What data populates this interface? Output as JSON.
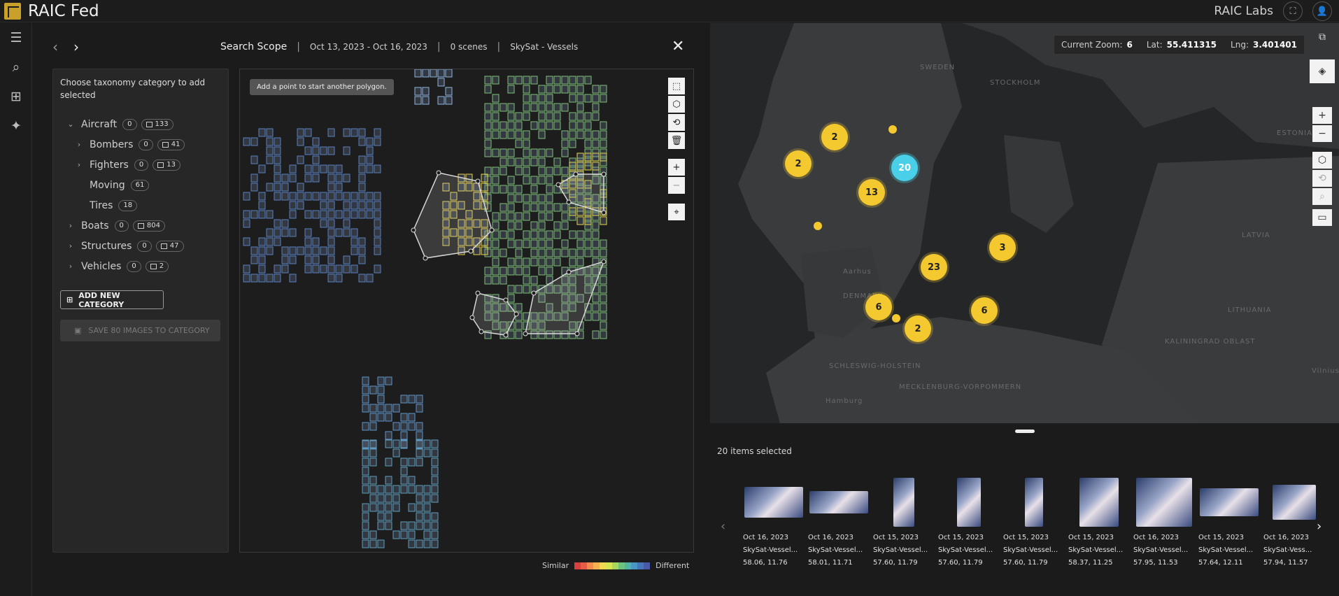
{
  "app": {
    "title": "RAIC Fed",
    "org": "RAIC Labs"
  },
  "scope": {
    "title": "Search Scope",
    "date_range": "Oct 13, 2023 - Oct 16, 2023",
    "scenes": "0 scenes",
    "source": "SkySat - Vessels",
    "sep": "|"
  },
  "taxonomy": {
    "hint": "Choose taxonomy category to add selected",
    "items": [
      {
        "label": "Aircraft",
        "count": "0",
        "images": "133",
        "level": 0,
        "chevron": "v"
      },
      {
        "label": "Bombers",
        "count": "0",
        "images": "41",
        "level": 1,
        "chevron": ">"
      },
      {
        "label": "Fighters",
        "count": "0",
        "images": "13",
        "level": 1,
        "chevron": ">"
      },
      {
        "label": "Moving",
        "count": "61",
        "images": "",
        "level": 1,
        "chevron": ""
      },
      {
        "label": "Tires",
        "count": "18",
        "images": "",
        "level": 1,
        "chevron": ""
      },
      {
        "label": "Boats",
        "count": "0",
        "images": "804",
        "level": 0,
        "chevron": ">"
      },
      {
        "label": "Structures",
        "count": "0",
        "images": "47",
        "level": 0,
        "chevron": ">"
      },
      {
        "label": "Vehicles",
        "count": "0",
        "images": "2",
        "level": 0,
        "chevron": ">"
      }
    ],
    "add_button": "ADD NEW CATEGORY",
    "save_button": "SAVE 80 IMAGES TO CATEGORY"
  },
  "search_map": {
    "tip": "Add a point to start another polygon."
  },
  "legend": {
    "similar": "Similar",
    "different": "Different",
    "colors": [
      "#d8403f",
      "#e85c45",
      "#f28a4d",
      "#f6b14f",
      "#f2d94f",
      "#d6e453",
      "#a5d85b",
      "#6cc37d",
      "#4fb3a5",
      "#4a97c4",
      "#4476bd",
      "#4a5aa8"
    ]
  },
  "world_map": {
    "zoom_label": "Current Zoom:",
    "zoom": "6",
    "lat_label": "Lat:",
    "lat": "55.411315",
    "lng_label": "Lng:",
    "lng": "3.401401",
    "places": [
      "SWEDEN",
      "STOCKHOLM",
      "ESTONIA",
      "LATVIA",
      "LITHUANIA",
      "KALININGRAD OBLAST",
      "DENMARK",
      "SCHLESWIG-HOLSTEIN",
      "MECKLENBURG-VORPOMMERN",
      "Aarhus",
      "Hamburg",
      "Vilnius"
    ],
    "clusters": [
      "2",
      "2",
      "20",
      "13",
      "3",
      "23",
      "6",
      "6",
      "2"
    ]
  },
  "results": {
    "selected": "20 items selected",
    "thumbnails": [
      {
        "date": "Oct 16, 2023",
        "name": "SkySat-Vessel...",
        "coords": "58.06, 11.76"
      },
      {
        "date": "Oct 16, 2023",
        "name": "SkySat-Vessel...",
        "coords": "58.01, 11.71"
      },
      {
        "date": "Oct 15, 2023",
        "name": "SkySat-Vessel...",
        "coords": "57.60, 11.79"
      },
      {
        "date": "Oct 15, 2023",
        "name": "SkySat-Vessel...",
        "coords": "57.60, 11.79"
      },
      {
        "date": "Oct 15, 2023",
        "name": "SkySat-Vessel...",
        "coords": "57.60, 11.79"
      },
      {
        "date": "Oct 15, 2023",
        "name": "SkySat-Vessel...",
        "coords": "58.37, 11.25"
      },
      {
        "date": "Oct 16, 2023",
        "name": "SkySat-Vessel...",
        "coords": "57.95, 11.53"
      },
      {
        "date": "Oct 15, 2023",
        "name": "SkySat-Vessel...",
        "coords": "57.64, 12.11"
      },
      {
        "date": "Oct 16, 2023",
        "name": "SkySat-Vess...",
        "coords": "57.94, 11.57"
      }
    ]
  }
}
